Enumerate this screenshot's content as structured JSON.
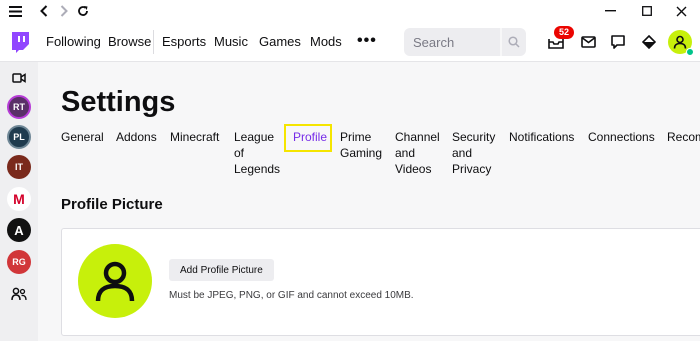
{
  "nav": {
    "links": [
      "Following",
      "Browse",
      "Esports",
      "Music",
      "Games",
      "Mods"
    ],
    "search_placeholder": "Search",
    "notification_count": "52"
  },
  "page": {
    "title": "Settings",
    "tabs": [
      [
        "General"
      ],
      [
        "Addons"
      ],
      [
        "Minecraft"
      ],
      [
        "League",
        "of",
        "Legends"
      ],
      [
        "Profile"
      ],
      [
        "Prime",
        "Gaming"
      ],
      [
        "Channel",
        "and",
        "Videos"
      ],
      [
        "Security",
        "and",
        "Privacy"
      ],
      [
        "Notifications"
      ],
      [
        "Connections"
      ],
      [
        "Recom"
      ]
    ],
    "active_tab": "Profile"
  },
  "profile_picture": {
    "section_title": "Profile Picture",
    "add_button": "Add Profile Picture",
    "hint": "Must be JPEG, PNG, or GIF and cannot exceed 10MB."
  },
  "sidebar": {
    "channels": [
      "RT",
      "PL",
      "IT",
      "M",
      "A",
      "RG"
    ]
  },
  "colors": {
    "brand": "#9146ff",
    "avatar": "#c7f00b",
    "active_tab": "#772ce8",
    "highlight": "#f5e500",
    "badge": "#eb0400"
  }
}
